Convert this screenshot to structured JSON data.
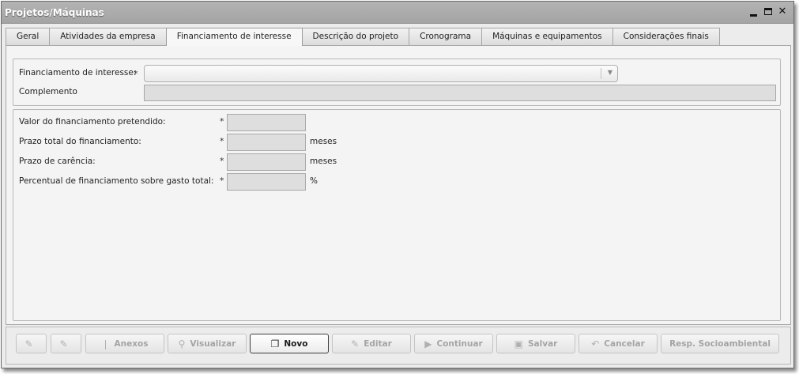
{
  "window": {
    "title": "Projetos/Máquinas",
    "controls": {
      "minimize": "minimize-icon",
      "maximize": "maximize-icon",
      "close": "✕"
    }
  },
  "tabs": [
    {
      "label": "Geral",
      "active": false
    },
    {
      "label": "Atividades da empresa",
      "active": false
    },
    {
      "label": "Financiamento de interesse",
      "active": true
    },
    {
      "label": "Descrição do projeto",
      "active": false
    },
    {
      "label": "Cronograma",
      "active": false
    },
    {
      "label": "Máquinas e equipamentos",
      "active": false
    },
    {
      "label": "Considerações finais",
      "active": false
    }
  ],
  "form": {
    "financiamento_label": "Financiamento de interesse:",
    "financiamento_value": "",
    "complemento_label": "Complemento",
    "complemento_value": "",
    "required_mark": "*",
    "valor_label": "Valor do financiamento pretendido:",
    "prazo_total_label": "Prazo total do financiamento:",
    "prazo_total_unit": "meses",
    "carencia_label": "Prazo de carência:",
    "carencia_unit": "meses",
    "percentual_label": "Percentual de financiamento sobre gasto total:",
    "percentual_unit": "%"
  },
  "toolbar": {
    "buttons": [
      {
        "label": "",
        "icon": "edit-doc-icon",
        "enabled": false
      },
      {
        "label": "",
        "icon": "edit-doc-icon",
        "enabled": false
      },
      {
        "label": "Anexos",
        "icon": "paperclip-icon",
        "enabled": false
      },
      {
        "label": "Visualizar",
        "icon": "magnifier-icon",
        "enabled": false
      },
      {
        "label": "Novo",
        "icon": "new-document-icon",
        "enabled": true
      },
      {
        "label": "Editar",
        "icon": "pencil-icon",
        "enabled": false
      },
      {
        "label": "Continuar",
        "icon": "play-icon",
        "enabled": false
      },
      {
        "label": "Salvar",
        "icon": "floppy-icon",
        "enabled": false
      },
      {
        "label": "Cancelar",
        "icon": "undo-arrow-icon",
        "enabled": false
      },
      {
        "label": "Resp. Socioambiental",
        "icon": "",
        "enabled": false
      }
    ]
  }
}
